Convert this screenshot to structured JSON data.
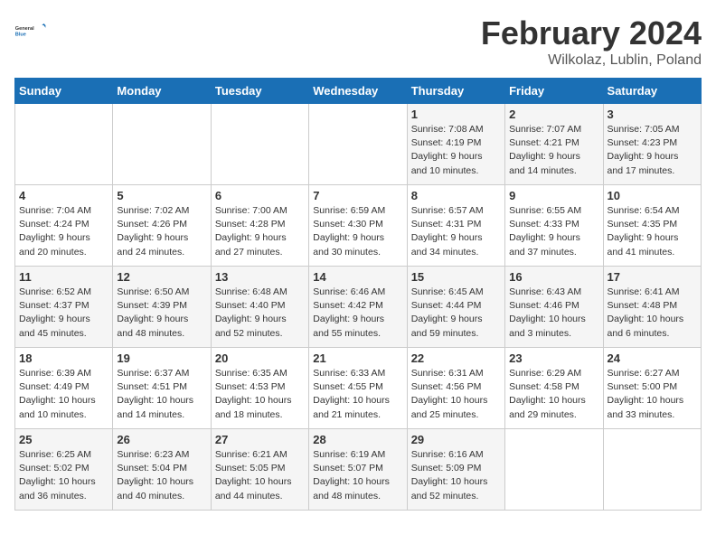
{
  "header": {
    "logo_general": "General",
    "logo_blue": "Blue",
    "month": "February 2024",
    "location": "Wilkolaz, Lublin, Poland"
  },
  "days_of_week": [
    "Sunday",
    "Monday",
    "Tuesday",
    "Wednesday",
    "Thursday",
    "Friday",
    "Saturday"
  ],
  "weeks": [
    [
      {
        "day": "",
        "info": ""
      },
      {
        "day": "",
        "info": ""
      },
      {
        "day": "",
        "info": ""
      },
      {
        "day": "",
        "info": ""
      },
      {
        "day": "1",
        "info": "Sunrise: 7:08 AM\nSunset: 4:19 PM\nDaylight: 9 hours\nand 10 minutes."
      },
      {
        "day": "2",
        "info": "Sunrise: 7:07 AM\nSunset: 4:21 PM\nDaylight: 9 hours\nand 14 minutes."
      },
      {
        "day": "3",
        "info": "Sunrise: 7:05 AM\nSunset: 4:23 PM\nDaylight: 9 hours\nand 17 minutes."
      }
    ],
    [
      {
        "day": "4",
        "info": "Sunrise: 7:04 AM\nSunset: 4:24 PM\nDaylight: 9 hours\nand 20 minutes."
      },
      {
        "day": "5",
        "info": "Sunrise: 7:02 AM\nSunset: 4:26 PM\nDaylight: 9 hours\nand 24 minutes."
      },
      {
        "day": "6",
        "info": "Sunrise: 7:00 AM\nSunset: 4:28 PM\nDaylight: 9 hours\nand 27 minutes."
      },
      {
        "day": "7",
        "info": "Sunrise: 6:59 AM\nSunset: 4:30 PM\nDaylight: 9 hours\nand 30 minutes."
      },
      {
        "day": "8",
        "info": "Sunrise: 6:57 AM\nSunset: 4:31 PM\nDaylight: 9 hours\nand 34 minutes."
      },
      {
        "day": "9",
        "info": "Sunrise: 6:55 AM\nSunset: 4:33 PM\nDaylight: 9 hours\nand 37 minutes."
      },
      {
        "day": "10",
        "info": "Sunrise: 6:54 AM\nSunset: 4:35 PM\nDaylight: 9 hours\nand 41 minutes."
      }
    ],
    [
      {
        "day": "11",
        "info": "Sunrise: 6:52 AM\nSunset: 4:37 PM\nDaylight: 9 hours\nand 45 minutes."
      },
      {
        "day": "12",
        "info": "Sunrise: 6:50 AM\nSunset: 4:39 PM\nDaylight: 9 hours\nand 48 minutes."
      },
      {
        "day": "13",
        "info": "Sunrise: 6:48 AM\nSunset: 4:40 PM\nDaylight: 9 hours\nand 52 minutes."
      },
      {
        "day": "14",
        "info": "Sunrise: 6:46 AM\nSunset: 4:42 PM\nDaylight: 9 hours\nand 55 minutes."
      },
      {
        "day": "15",
        "info": "Sunrise: 6:45 AM\nSunset: 4:44 PM\nDaylight: 9 hours\nand 59 minutes."
      },
      {
        "day": "16",
        "info": "Sunrise: 6:43 AM\nSunset: 4:46 PM\nDaylight: 10 hours\nand 3 minutes."
      },
      {
        "day": "17",
        "info": "Sunrise: 6:41 AM\nSunset: 4:48 PM\nDaylight: 10 hours\nand 6 minutes."
      }
    ],
    [
      {
        "day": "18",
        "info": "Sunrise: 6:39 AM\nSunset: 4:49 PM\nDaylight: 10 hours\nand 10 minutes."
      },
      {
        "day": "19",
        "info": "Sunrise: 6:37 AM\nSunset: 4:51 PM\nDaylight: 10 hours\nand 14 minutes."
      },
      {
        "day": "20",
        "info": "Sunrise: 6:35 AM\nSunset: 4:53 PM\nDaylight: 10 hours\nand 18 minutes."
      },
      {
        "day": "21",
        "info": "Sunrise: 6:33 AM\nSunset: 4:55 PM\nDaylight: 10 hours\nand 21 minutes."
      },
      {
        "day": "22",
        "info": "Sunrise: 6:31 AM\nSunset: 4:56 PM\nDaylight: 10 hours\nand 25 minutes."
      },
      {
        "day": "23",
        "info": "Sunrise: 6:29 AM\nSunset: 4:58 PM\nDaylight: 10 hours\nand 29 minutes."
      },
      {
        "day": "24",
        "info": "Sunrise: 6:27 AM\nSunset: 5:00 PM\nDaylight: 10 hours\nand 33 minutes."
      }
    ],
    [
      {
        "day": "25",
        "info": "Sunrise: 6:25 AM\nSunset: 5:02 PM\nDaylight: 10 hours\nand 36 minutes."
      },
      {
        "day": "26",
        "info": "Sunrise: 6:23 AM\nSunset: 5:04 PM\nDaylight: 10 hours\nand 40 minutes."
      },
      {
        "day": "27",
        "info": "Sunrise: 6:21 AM\nSunset: 5:05 PM\nDaylight: 10 hours\nand 44 minutes."
      },
      {
        "day": "28",
        "info": "Sunrise: 6:19 AM\nSunset: 5:07 PM\nDaylight: 10 hours\nand 48 minutes."
      },
      {
        "day": "29",
        "info": "Sunrise: 6:16 AM\nSunset: 5:09 PM\nDaylight: 10 hours\nand 52 minutes."
      },
      {
        "day": "",
        "info": ""
      },
      {
        "day": "",
        "info": ""
      }
    ]
  ]
}
